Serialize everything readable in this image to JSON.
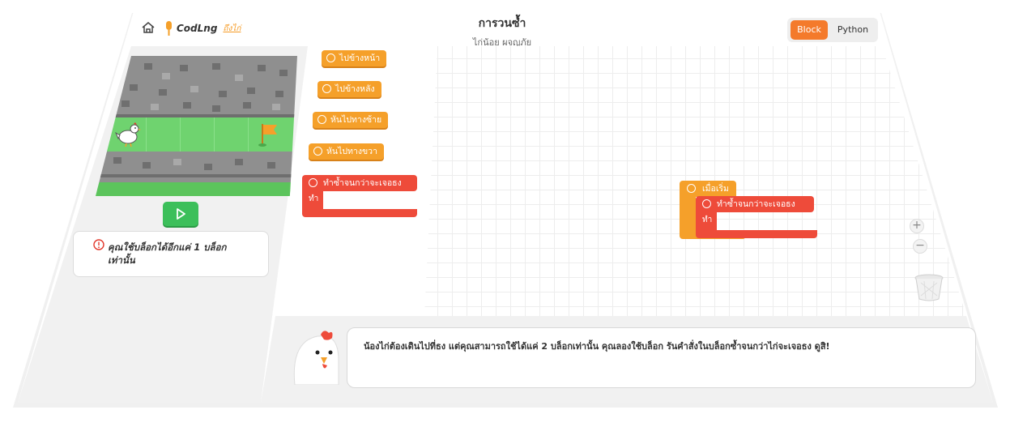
{
  "header": {
    "logo_text": "CodLng",
    "logo_sub": "ถึงไก่",
    "title": "การวนซ้ำ",
    "subtitle": "ไก่น้อย ผจญภัย",
    "mode_block": "Block",
    "mode_python": "Python"
  },
  "left_panel": {
    "hint_text": "คุณใช้บล็อกได้อีกแค่ 1 บล็อกเท่านั้น"
  },
  "toolbox": {
    "blocks": [
      {
        "label": "ไปข้างหน้า"
      },
      {
        "label": "ไปข้างหลัง"
      },
      {
        "label": "หันไปทางซ้าย"
      },
      {
        "label": "หันไปทางขวา"
      }
    ],
    "loop_label": "ทำซ้ำจนกว่าจะเจอธง",
    "loop_do": "ทำ"
  },
  "workspace": {
    "start_label": "เมื่อเริ่ม",
    "loop_label": "ทำซ้ำจนกว่าจะเจอธง",
    "loop_do": "ทำ",
    "zoom_in": "+",
    "zoom_out": "−"
  },
  "dialog": {
    "text": "น้องไก่ต้องเดินไปที่ธง แต่คุณสามารถใช้ได้แค่ 2 บล็อกเท่านั้น คุณลองใช้บล็อก รันคำสั่งในบล็อกซ้ำจนกว่าไก่จะเจอธง ดูสิ!"
  },
  "colors": {
    "accent": "#f47a2b",
    "motion_block": "#f5a02a",
    "loop_block": "#ee4b3a",
    "run_button": "#3cbf5a"
  }
}
